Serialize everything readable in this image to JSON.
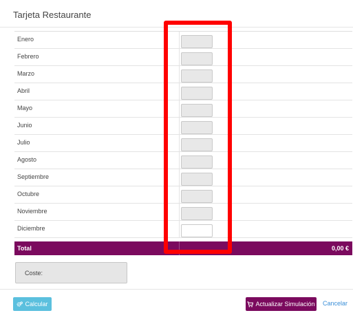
{
  "header": {
    "title": "Tarjeta Restaurante"
  },
  "months": [
    {
      "label": "Enero",
      "value": ""
    },
    {
      "label": "Febrero",
      "value": ""
    },
    {
      "label": "Marzo",
      "value": ""
    },
    {
      "label": "Abril",
      "value": ""
    },
    {
      "label": "Mayo",
      "value": ""
    },
    {
      "label": "Junio",
      "value": ""
    },
    {
      "label": "Julio",
      "value": ""
    },
    {
      "label": "Agosto",
      "value": ""
    },
    {
      "label": "Septiembre",
      "value": ""
    },
    {
      "label": "Octubre",
      "value": ""
    },
    {
      "label": "Noviembre",
      "value": ""
    },
    {
      "label": "Diciembre",
      "value": ""
    }
  ],
  "total": {
    "label": "Total",
    "value": "0,00 €"
  },
  "coste": {
    "label": "Coste:"
  },
  "footer": {
    "calcular_label": "Calcular",
    "actualizar_label": "Actualizar Simulación",
    "cancelar_label": "Cancelar"
  },
  "colors": {
    "accent": "#7b0a5e",
    "info": "#5bc0de",
    "highlight": "#ff0000",
    "link": "#3a8fd8"
  },
  "icons": {
    "calcular": "cogs-icon",
    "actualizar": "cart-icon"
  }
}
